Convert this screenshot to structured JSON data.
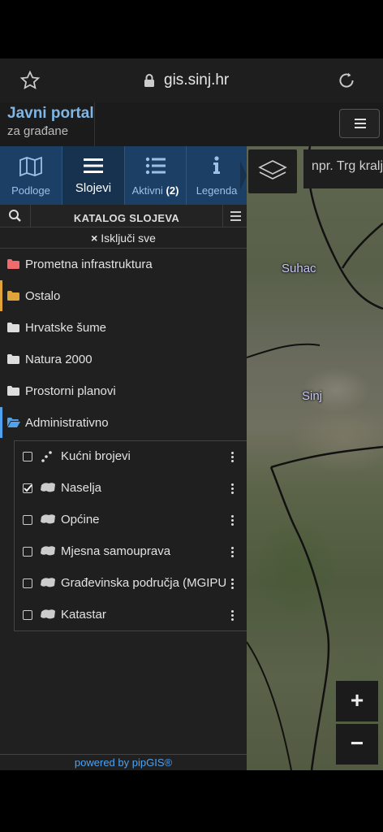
{
  "browser": {
    "domain": "gis.sinj.hr"
  },
  "header": {
    "title": "Javni portal",
    "subtitle": "za građane"
  },
  "tabs": [
    {
      "label": "Podloge",
      "icon": "map-icon"
    },
    {
      "label": "Slojevi",
      "icon": "layers-list-icon",
      "active": true
    },
    {
      "label": "Aktivni",
      "count": "(2)",
      "icon": "list-icon"
    },
    {
      "label": "Legenda",
      "icon": "info-icon"
    }
  ],
  "catalog": {
    "title": "KATALOG SLOJEVA",
    "disable_all": "Isključi sve"
  },
  "folders": [
    {
      "label": "Prometna infrastruktura",
      "color": "#f06b6b"
    },
    {
      "label": "Ostalo",
      "color": "#e0a33a"
    },
    {
      "label": "Hrvatske šume",
      "color": "#dddddd"
    },
    {
      "label": "Natura 2000",
      "color": "#dddddd"
    },
    {
      "label": "Prostorni planovi",
      "color": "#dddddd"
    },
    {
      "label": "Administrativno",
      "color": "#4ea2f0",
      "open": true
    }
  ],
  "layers": [
    {
      "label": "Kućni brojevi",
      "checked": false,
      "icon": "points-icon"
    },
    {
      "label": "Naselja",
      "checked": true,
      "icon": "polygon-icon"
    },
    {
      "label": "Općine",
      "checked": false,
      "icon": "polygon-icon"
    },
    {
      "label": "Mjesna samouprava",
      "checked": false,
      "icon": "polygon-icon"
    },
    {
      "label": "Građevinska područja (MGIPU)",
      "checked": false,
      "icon": "polygon-icon"
    },
    {
      "label": "Katastar",
      "checked": false,
      "icon": "polygon-icon"
    }
  ],
  "map": {
    "search_placeholder": "npr. Trg kralja",
    "places": [
      "Suhac",
      "Sinj"
    ],
    "zoom_in": "+",
    "zoom_out": "−"
  },
  "footer": {
    "powered": "powered by pipGIS®"
  }
}
